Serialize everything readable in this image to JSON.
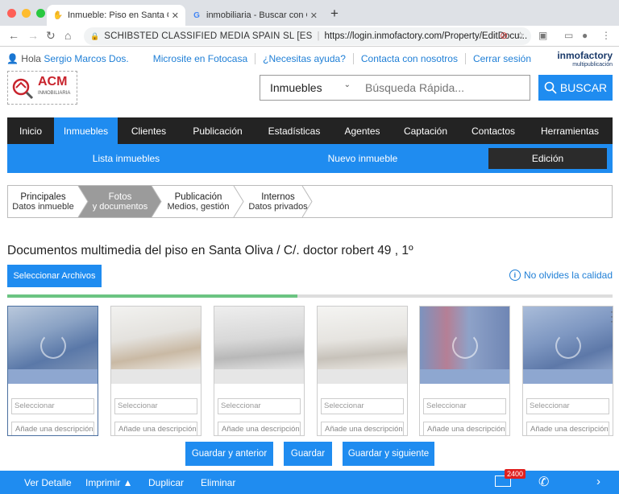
{
  "browser": {
    "tabs": [
      {
        "title": "Inmueble: Piso en Santa Oliva / C",
        "active": true,
        "favicon": "hand-icon"
      },
      {
        "title": "inmobiliaria - Buscar con Googl",
        "active": false,
        "favicon": "google-icon"
      }
    ],
    "cert": "SCHIBSTED CLASSIFIED MEDIA SPAIN SL [ES",
    "url": "https://login.inmofactory.com/Property/EditDocu..."
  },
  "top": {
    "greeting": "Hola",
    "user": "Sergio Marcos Dos.",
    "links": [
      "Microsite en Fotocasa",
      "¿Necesitas ayuda?",
      "Contacta con nosotros",
      "Cerrar sesión"
    ],
    "brand": "inmofactory",
    "brand_sub": "multipublicación"
  },
  "logo": {
    "name": "ACM",
    "sub": "INMOBILIARIA"
  },
  "search": {
    "category": "Inmuebles",
    "placeholder": "Búsqueda Rápida...",
    "button": "BUSCAR"
  },
  "nav": {
    "items": [
      "Inicio",
      "Inmuebles",
      "Clientes",
      "Publicación",
      "Estadísticas",
      "Agentes",
      "Captación",
      "Contactos",
      "Herramientas"
    ],
    "active_index": 1
  },
  "subnav": {
    "items": [
      "Lista inmuebles",
      "Nuevo inmueble",
      "Edición"
    ]
  },
  "steps": [
    {
      "title": "Principales",
      "sub": "Datos inmueble"
    },
    {
      "title": "Fotos",
      "sub": "y documentos"
    },
    {
      "title": "Publicación",
      "sub": "Medios, gestión"
    },
    {
      "title": "Internos",
      "sub": "Datos privados"
    }
  ],
  "page": {
    "heading": "Documentos multimedia del piso en Santa Oliva / C/. doctor robert 49 , 1º",
    "select_files": "Seleccionar Archivos",
    "quality": "No olvides la calidad",
    "upload_progress": 0.48
  },
  "photos": [
    {
      "select": "Seleccionar",
      "desc": "Añade una descripción"
    },
    {
      "select": "Seleccionar",
      "desc": "Añade una descripción"
    },
    {
      "select": "Seleccionar",
      "desc": "Añade una descripción"
    },
    {
      "select": "Seleccionar",
      "desc": "Añade una descripción"
    },
    {
      "select": "Seleccionar",
      "desc": "Añade una descripción"
    },
    {
      "select": "Seleccionar",
      "desc": "Añade una descripción"
    }
  ],
  "actions": {
    "prev": "Guardar y anterior",
    "save": "Guardar",
    "next": "Guardar y siguiente"
  },
  "footer": {
    "items": [
      "Ver Detalle",
      "Imprimir ▲",
      "Duplicar",
      "Eliminar"
    ],
    "mail_count": "2400"
  },
  "colors": {
    "accent": "#1f8cf0",
    "nav_dark": "#232323"
  }
}
